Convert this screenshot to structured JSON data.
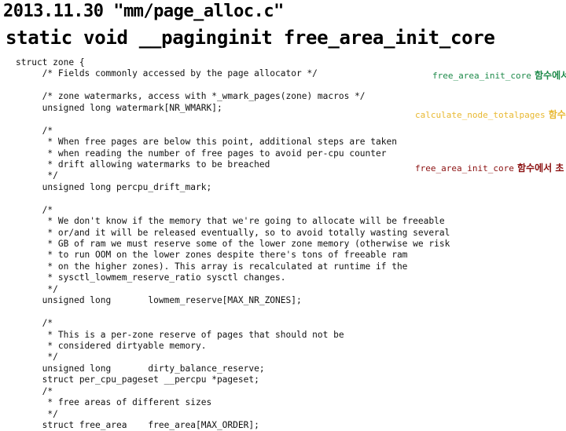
{
  "header": {
    "title": "2013.11.30 \"mm/page_alloc.c\"",
    "function_signature": "static void __paginginit free_area_init_core"
  },
  "code_lines": [
    "struct zone {",
    "     /* Fields commonly accessed by the page allocator */",
    "",
    "     /* zone watermarks, access with *_wmark_pages(zone) macros */",
    "     unsigned long watermark[NR_WMARK];",
    "",
    "     /*",
    "      * When free pages are below this point, additional steps are taken",
    "      * when reading the number of free pages to avoid per-cpu counter",
    "      * drift allowing watermarks to be breached",
    "      */",
    "     unsigned long percpu_drift_mark;",
    "",
    "     /*",
    "      * We don't know if the memory that we're going to allocate will be freeable",
    "      * or/and it will be released eventually, so to avoid totally wasting several",
    "      * GB of ram we must reserve some of the lower zone memory (otherwise we risk",
    "      * to run OOM on the lower zones despite there's tons of freeable ram",
    "      * on the higher zones). This array is recalculated at runtime if the",
    "      * sysctl_lowmem_reserve_ratio sysctl changes.",
    "      */",
    "     unsigned long       lowmem_reserve[MAX_NR_ZONES];",
    "",
    "     /*",
    "      * This is a per-zone reserve of pages that should not be",
    "      * considered dirtyable memory.",
    "      */",
    "     unsigned long       dirty_balance_reserve;",
    "     struct per_cpu_pageset __percpu *pageset;",
    "     /*",
    "      * free areas of different sizes",
    "      */",
    "     struct free_area    free_area[MAX_ORDER];"
  ],
  "annotations": [
    {
      "func": "free_area_init_core",
      "korean": " 함수에서",
      "color": "#1e8a4a"
    },
    {
      "func": "calculate_node_totalpages",
      "korean": " 함수",
      "color": "#e8b830"
    },
    {
      "func": "free_area_init_core",
      "korean": " 함수에서 초",
      "color": "#8b1010"
    }
  ]
}
